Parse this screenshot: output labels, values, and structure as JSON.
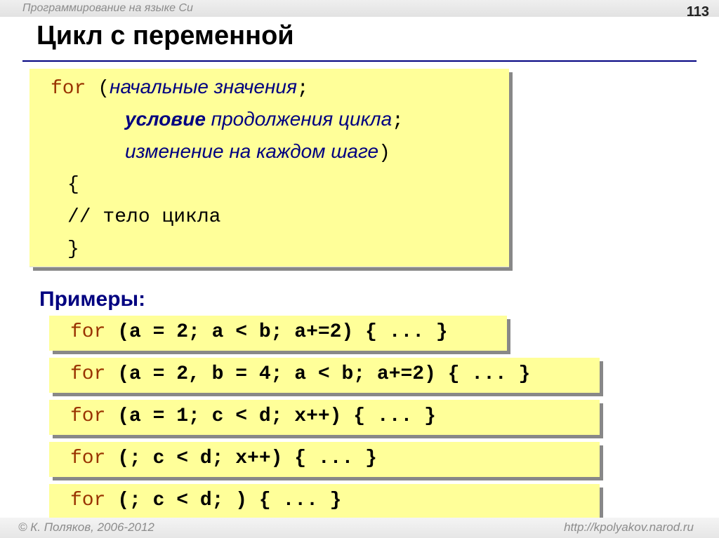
{
  "header": {
    "course": "Программирование на языке Си",
    "page_number": "113"
  },
  "slide": {
    "title": "Цикл с переменной"
  },
  "syntax": {
    "kw_for": "for",
    "paren_open": "(",
    "init": "начальные значения",
    "sep1": ";",
    "cond_bold": "условие",
    "cond_rest": " продолжения цикла",
    "sep2": ";",
    "step": "изменение на каждом шаге",
    "paren_close": ")",
    "brace_open": "{",
    "body_comment": "// тело цикла",
    "brace_close": "}"
  },
  "examples": {
    "label": "Примеры:",
    "items": [
      {
        "kw": "for",
        "code": " (a = 2; a < b; a+=2) { ... }"
      },
      {
        "kw": "for",
        "code": " (a = 2, b = 4; a < b; a+=2) { ... }"
      },
      {
        "kw": "for",
        "code": " (a = 1; c < d; x++) { ... }"
      },
      {
        "kw": "for",
        "code": " (; c < d; x++) { ... }"
      },
      {
        "kw": "for",
        "code": " (; c < d; ) { ... }"
      }
    ]
  },
  "footer": {
    "copyright": "© К. Поляков, 2006-2012",
    "url": "http://kpolyakov.narod.ru"
  },
  "colors": {
    "keyword": "#993300",
    "accent_blue": "#000080",
    "code_background": "#ffff99"
  }
}
